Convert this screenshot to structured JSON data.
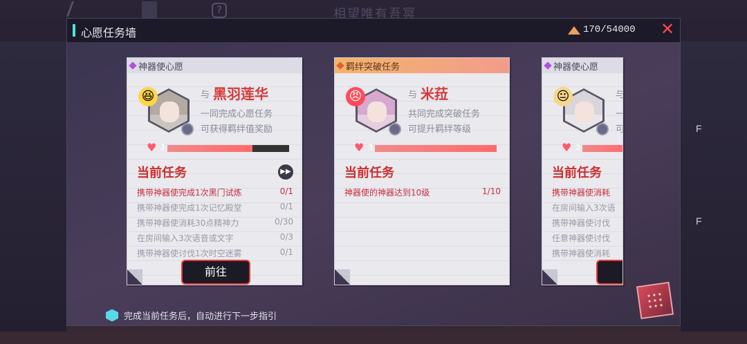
{
  "background": {
    "title": "相望唯有吾冥"
  },
  "panel": {
    "title": "心愿任务墙",
    "currency": "170/54000",
    "footer_hint": "完成当前任务后，自动进行下一步指引"
  },
  "cards": [
    {
      "type_label": "神器使心愿",
      "with": "与",
      "name": "黑羽莲华",
      "desc1": "一同完成心愿任务",
      "desc2": "可获得羁绊值奖励",
      "level": "2",
      "bond_progress": 0.7,
      "current_task_label": "当前任务",
      "go_label": "前往",
      "tasks": [
        {
          "name": "携带神器使完成1次黑门试炼",
          "progress": "0/1"
        },
        {
          "name": "携带神器使完成1次记忆殿堂",
          "progress": "0/1"
        },
        {
          "name": "携带神器使消耗30点精神力",
          "progress": "0/30"
        },
        {
          "name": "在房间输入3次语音或文字",
          "progress": "0/3"
        },
        {
          "name": "携带神器使讨伐1次时空迷雾",
          "progress": "0/1"
        }
      ]
    },
    {
      "type_label": "羁绊突破任务",
      "with": "与",
      "name": "米菈",
      "desc1": "共同完成突破任务",
      "desc2": "可提升羁绊等级",
      "level": "3",
      "bond_progress": 1.0,
      "current_task_label": "当前任务",
      "tasks": [
        {
          "name": "神器使的神器达到10级",
          "progress": "1/10"
        }
      ]
    },
    {
      "type_label": "神器使心愿",
      "with": "与",
      "name": "",
      "desc1": "一",
      "desc2": "可",
      "level": "3",
      "bond_progress": 0.35,
      "current_task_label": "当前任务",
      "go_label": "前",
      "tasks": [
        {
          "name": "携带神器使消耗",
          "progress": ""
        },
        {
          "name": "在房间输入3次语",
          "progress": ""
        },
        {
          "name": "携带神器使讨伐",
          "progress": ""
        },
        {
          "name": "任意神器使讨伐",
          "progress": ""
        },
        {
          "name": "携带神器使消耗",
          "progress": ""
        }
      ]
    }
  ],
  "side_right": {
    "f1": "F",
    "f2": "F"
  },
  "colors": {
    "accent": "#4fe3e0",
    "task_active": "#c62e3e",
    "close": "#ff4a4a"
  }
}
